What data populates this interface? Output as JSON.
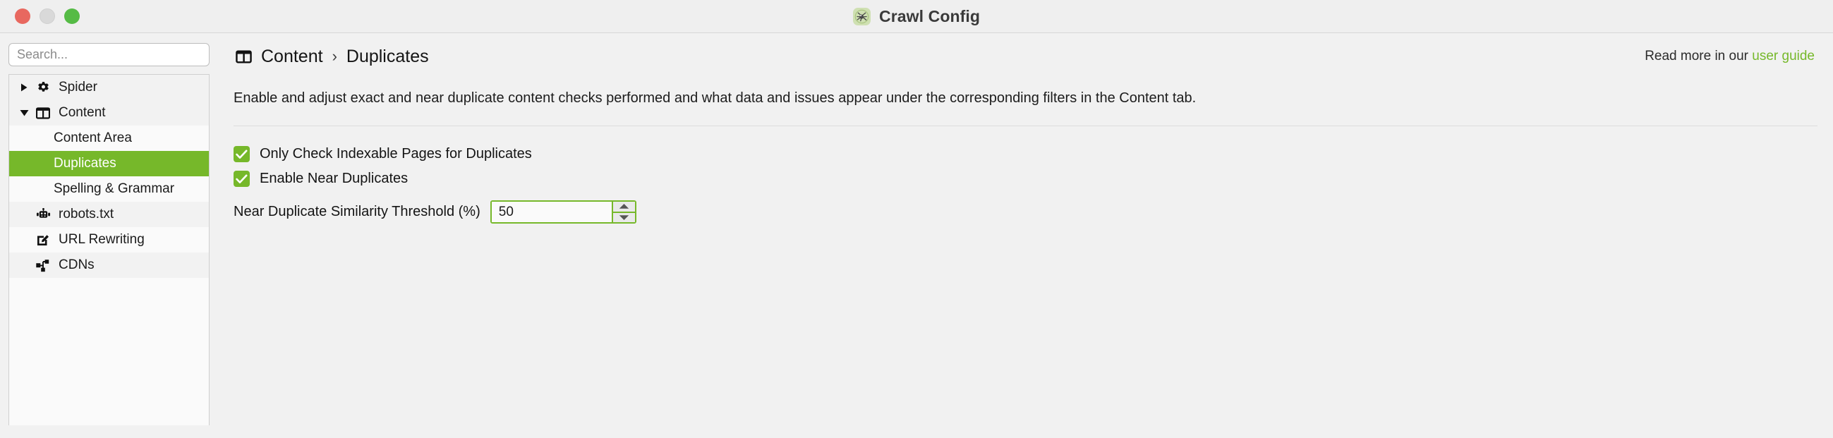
{
  "window": {
    "title": "Crawl Config",
    "app_icon": "spider-logo-icon",
    "controls": {
      "close": "close-window-button",
      "minimize": "minimize-window-button",
      "maximize": "maximize-window-button"
    }
  },
  "sidebar": {
    "search": {
      "value": "",
      "placeholder": "Search..."
    },
    "items": [
      {
        "label": "Spider",
        "icon": "gear-icon",
        "twisty": "collapsed",
        "level": 0,
        "selected": false,
        "shade": "alt"
      },
      {
        "label": "Content",
        "icon": "columns-icon",
        "twisty": "expanded",
        "level": 0,
        "selected": false,
        "shade": "alt"
      },
      {
        "label": "Content Area",
        "icon": "",
        "twisty": "",
        "level": 1,
        "selected": false,
        "shade": "plain"
      },
      {
        "label": "Duplicates",
        "icon": "",
        "twisty": "",
        "level": 1,
        "selected": true,
        "shade": "plain"
      },
      {
        "label": "Spelling & Grammar",
        "icon": "",
        "twisty": "",
        "level": 1,
        "selected": false,
        "shade": "plain"
      },
      {
        "label": "robots.txt",
        "icon": "robot-icon",
        "twisty": "",
        "level": 0,
        "selected": false,
        "shade": "alt"
      },
      {
        "label": "URL Rewriting",
        "icon": "pencil-square-icon",
        "twisty": "",
        "level": 0,
        "selected": false,
        "shade": "plain"
      },
      {
        "label": "CDNs",
        "icon": "network-nodes-icon",
        "twisty": "",
        "level": 0,
        "selected": false,
        "shade": "alt"
      }
    ]
  },
  "main": {
    "breadcrumb": {
      "icon": "columns-icon",
      "parent": "Content",
      "separator": "›",
      "current": "Duplicates"
    },
    "read_more": {
      "prefix": "Read more in our ",
      "link": "user guide"
    },
    "description": "Enable and adjust exact and near duplicate content checks performed and what data and issues appear under the corresponding filters in the Content tab.",
    "options": [
      {
        "label": "Only Check Indexable Pages for Duplicates",
        "checked": true
      },
      {
        "label": "Enable Near Duplicates",
        "checked": true
      }
    ],
    "threshold": {
      "label": "Near Duplicate Similarity Threshold (%)",
      "value": "50",
      "increment_icon": "triangle-up-icon",
      "decrement_icon": "triangle-down-icon"
    }
  },
  "colors": {
    "accent_green": "#76b82a",
    "selected_row": "#76b82a",
    "link_green": "#76b82a",
    "window_bg": "#f1f1f1",
    "traffic_red": "#e8685f",
    "traffic_yellow": "#d9d9d9",
    "traffic_green": "#55bb45"
  }
}
